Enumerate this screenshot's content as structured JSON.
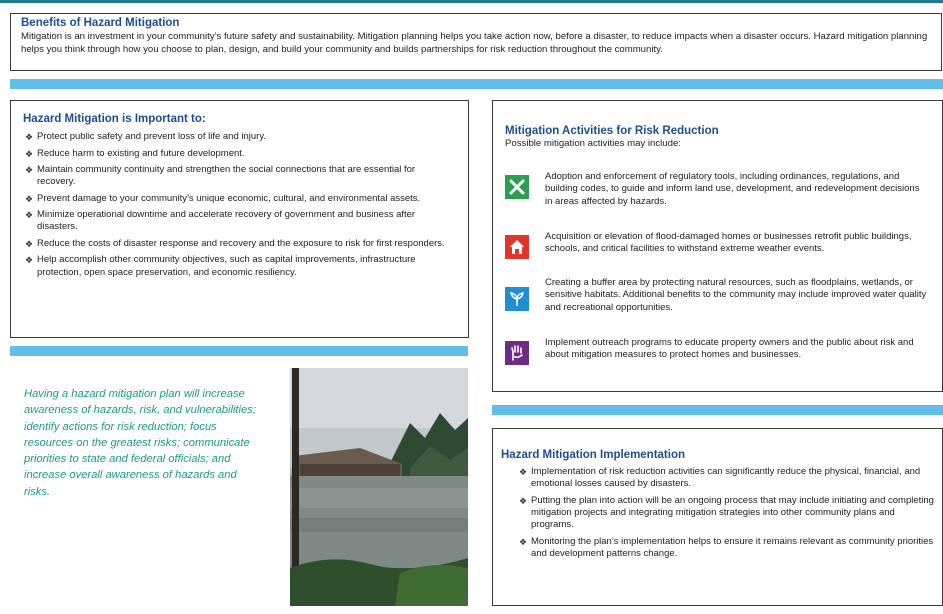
{
  "benefits": {
    "title": "Benefits of Hazard Mitigation",
    "text": "Mitigation is an investment in your community’s future safety and sustainability. Mitigation planning helps you take action now, before a disaster, to reduce impacts when a disaster occurs. Hazard mitigation planning helps you think through how you choose to plan, design, and build your community and builds partnerships for risk reduction throughout the community."
  },
  "important": {
    "title": "Hazard Mitigation is Important to:",
    "bullet_glyph": "❖",
    "items": [
      "Protect public safety and prevent loss of life and injury.",
      "Reduce harm to existing and future development.",
      "Maintain community continuity and strengthen the social connections that are essential for recovery.",
      "Prevent damage to your community’s unique economic, cultural, and environmental assets.",
      "Minimize operational downtime and accelerate recovery of government and business after disasters.",
      "Reduce the costs of disaster response and recovery and the exposure to risk for first responders.",
      "Help accomplish other community objectives, such as capital improvements, infrastructure protection, open space preservation, and economic resiliency."
    ]
  },
  "quote": "Having a hazard mitigation plan will increase awareness of hazards, risk, and vulnerabilities; identify actions for risk reduction; focus resources on the greatest risks; communicate priorities to state and federal officials; and increase overall awareness of hazards and risks.",
  "activities": {
    "title": "Mitigation Activities for Risk Reduction",
    "subtitle": "Possible mitigation activities may include:",
    "items": [
      {
        "icon": "tools-icon",
        "color": "#2e9e4f",
        "text": "Adoption and enforcement of regulatory tools, including ordinances, regulations, and building codes, to guide and inform land use, development, and redevelopment decisions in areas affected by hazards."
      },
      {
        "icon": "house-icon",
        "color": "#e0352b",
        "text": "Acquisition or elevation of flood-damaged homes or businesses retrofit public buildings, schools, and critical facilities to withstand extreme weather events."
      },
      {
        "icon": "plant-icon",
        "color": "#1f8fd1",
        "text": "Creating a buffer area by protecting natural resources, such as floodplains, wetlands, or sensitive habitats. Additional benefits to the community may include improved water quality and recreational opportunities."
      },
      {
        "icon": "hand-icon",
        "color": "#6a2c84",
        "text": "Implement outreach programs to educate property owners and the public about risk and about mitigation measures to protect homes and businesses."
      }
    ]
  },
  "implementation": {
    "title": "Hazard Mitigation Implementation",
    "items": [
      "Implementation of risk reduction activities can significantly reduce the physical, financial, and emotional losses caused by disasters.",
      "Putting the plan into action will be an ongoing process that may include initiating and completing mitigation projects and integrating mitigation strategies into other community plans and programs.",
      "Monitoring the plan’s implementation helps to ensure it remains relevant as community priorities and development patterns change."
    ]
  }
}
